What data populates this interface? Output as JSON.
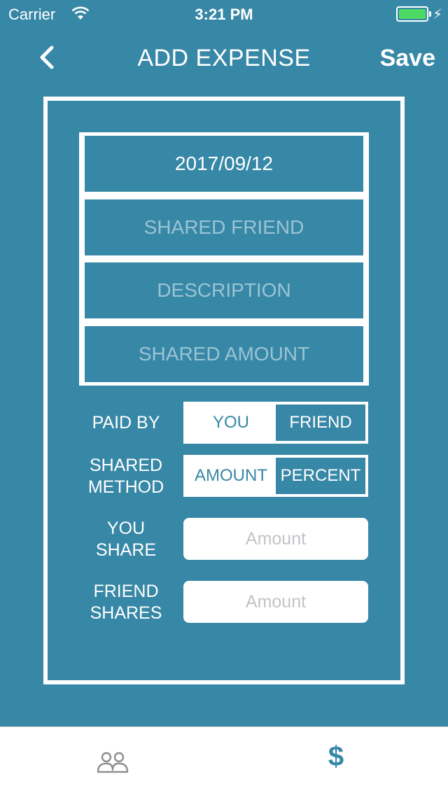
{
  "status_bar": {
    "carrier": "Carrier",
    "time": "3:21 PM",
    "battery_color": "#4cd964"
  },
  "nav": {
    "title": "ADD EXPENSE",
    "save_label": "Save",
    "back_icon": "chevron-left-icon"
  },
  "form": {
    "date": "2017/09/12",
    "shared_friend_placeholder": "SHARED FRIEND",
    "description_placeholder": "DESCRIPTION",
    "shared_amount_placeholder": "SHARED AMOUNT"
  },
  "paid_by": {
    "label": "PAID BY",
    "options": [
      "YOU",
      "FRIEND"
    ],
    "selected": "FRIEND"
  },
  "shared_method": {
    "label_line1": "SHARED",
    "label_line2": "METHOD",
    "options": [
      "AMOUNT",
      "PERCENT"
    ],
    "selected": "PERCENT"
  },
  "you_share": {
    "label_line1": "YOU",
    "label_line2": "SHARE",
    "placeholder": "Amount"
  },
  "friend_shares": {
    "label_line1": "FRIEND",
    "label_line2": "SHARES",
    "placeholder": "Amount"
  },
  "tab_bar": {
    "tabs": [
      {
        "icon": "friends-icon"
      },
      {
        "icon": "dollar-icon",
        "glyph": "$"
      }
    ]
  },
  "colors": {
    "background": "#3787a6",
    "accent": "#3787a6",
    "placeholder_text": "#9bc4d4"
  }
}
